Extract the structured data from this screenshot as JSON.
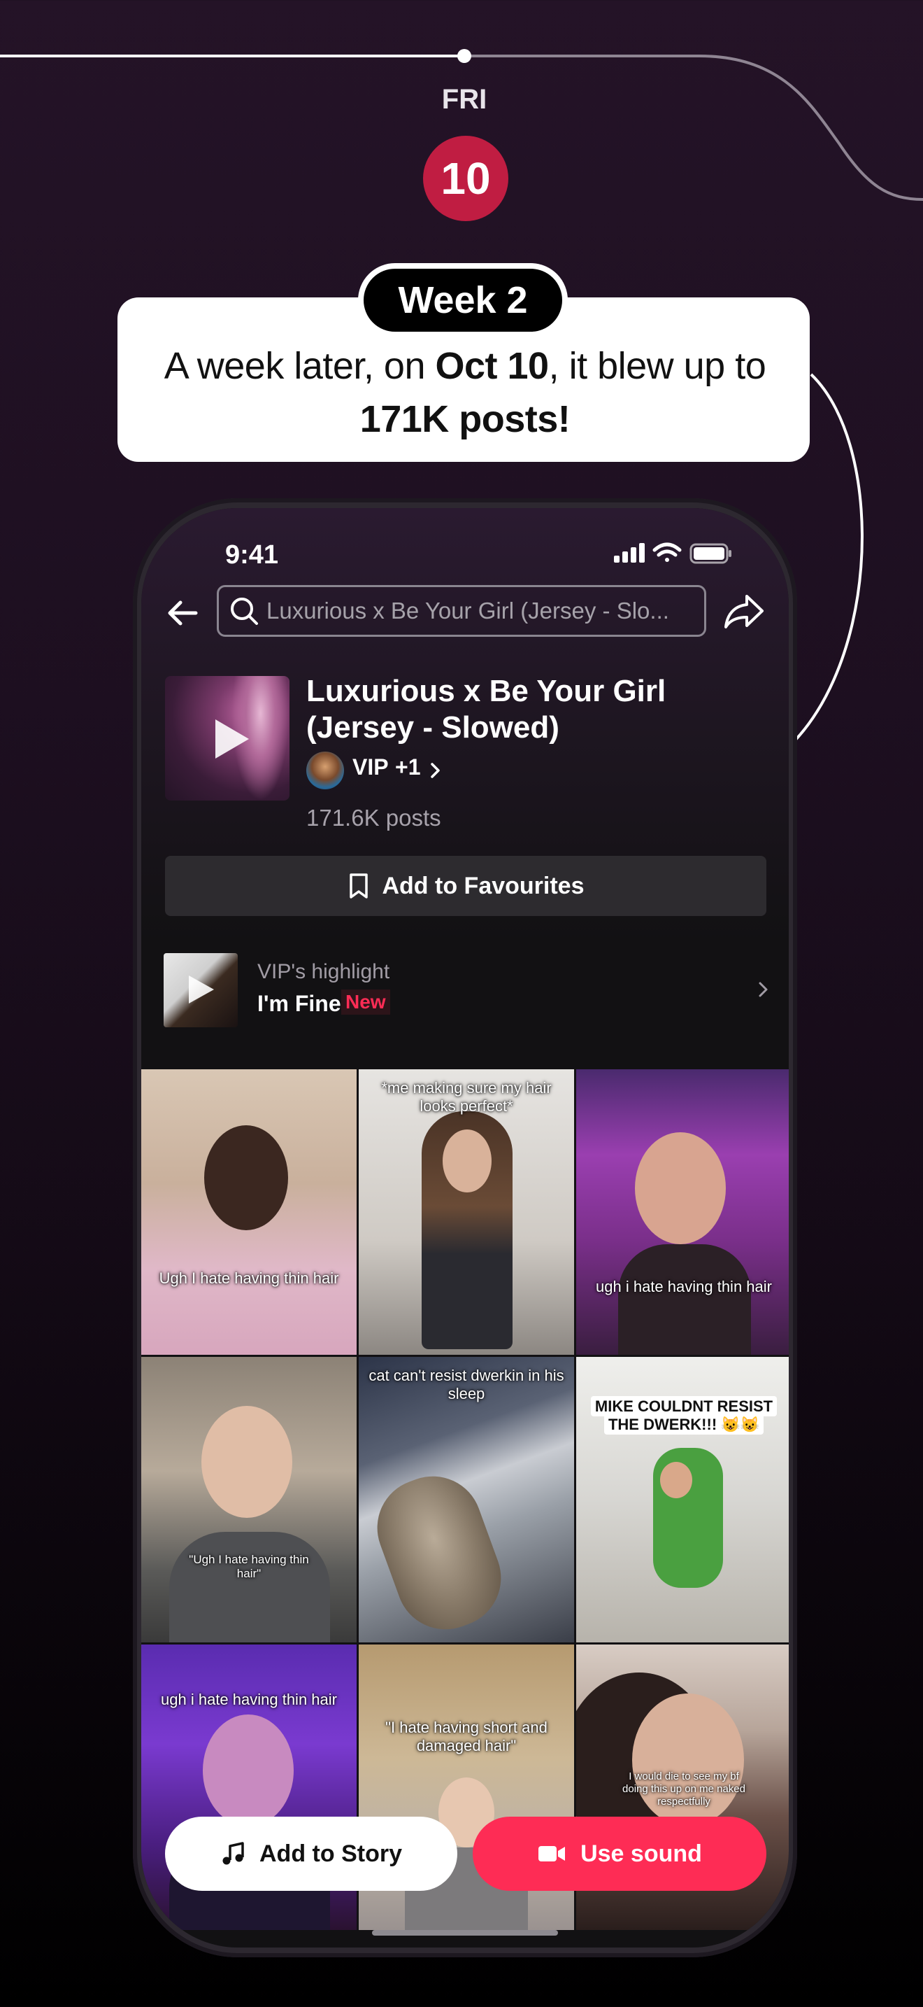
{
  "timeline": {
    "day": "FRI",
    "date": "10"
  },
  "callout": {
    "week": "Week 2",
    "text_before": "A week later, on ",
    "text_bold_date": "Oct 10",
    "text_middle": ", it blew up to ",
    "text_bold_count": "171K posts!"
  },
  "status_bar": {
    "time": "9:41",
    "icons": [
      "signal-icon",
      "wifi-icon",
      "battery-icon"
    ]
  },
  "search": {
    "value": "Luxurious x Be Your Girl (Jersey - Slo..."
  },
  "sound": {
    "title": "Luxurious x Be Your Girl (Jersey - Slowed)",
    "artist": "VIP",
    "artist_more": "+1",
    "post_count": "171.6K posts",
    "favourites_label": "Add to Favourites"
  },
  "highlight": {
    "label": "VIP's highlight",
    "song": "I'm Fine",
    "badge": "New"
  },
  "videos": [
    {
      "caption": "Ugh I hate having thin hair"
    },
    {
      "caption": "*me making sure my hair looks perfect*"
    },
    {
      "caption": "ugh i hate having thin hair"
    },
    {
      "caption": "\"Ugh I hate having thin hair\""
    },
    {
      "caption": "cat can't resist dwerkin in his sleep"
    },
    {
      "caption": "MIKE COULDNT RESIST THE DWERK!!! 😺😺"
    },
    {
      "caption": "ugh i hate having thin hair"
    },
    {
      "caption": "\"I hate having short and damaged hair\""
    },
    {
      "caption": "I would die to see my bf doing this up on me naked respectfully"
    }
  ],
  "actions": {
    "story_label": "Add to Story",
    "sound_label": "Use sound"
  },
  "colors": {
    "accent": "#fe2c55",
    "date_badge": "#c01d42"
  }
}
